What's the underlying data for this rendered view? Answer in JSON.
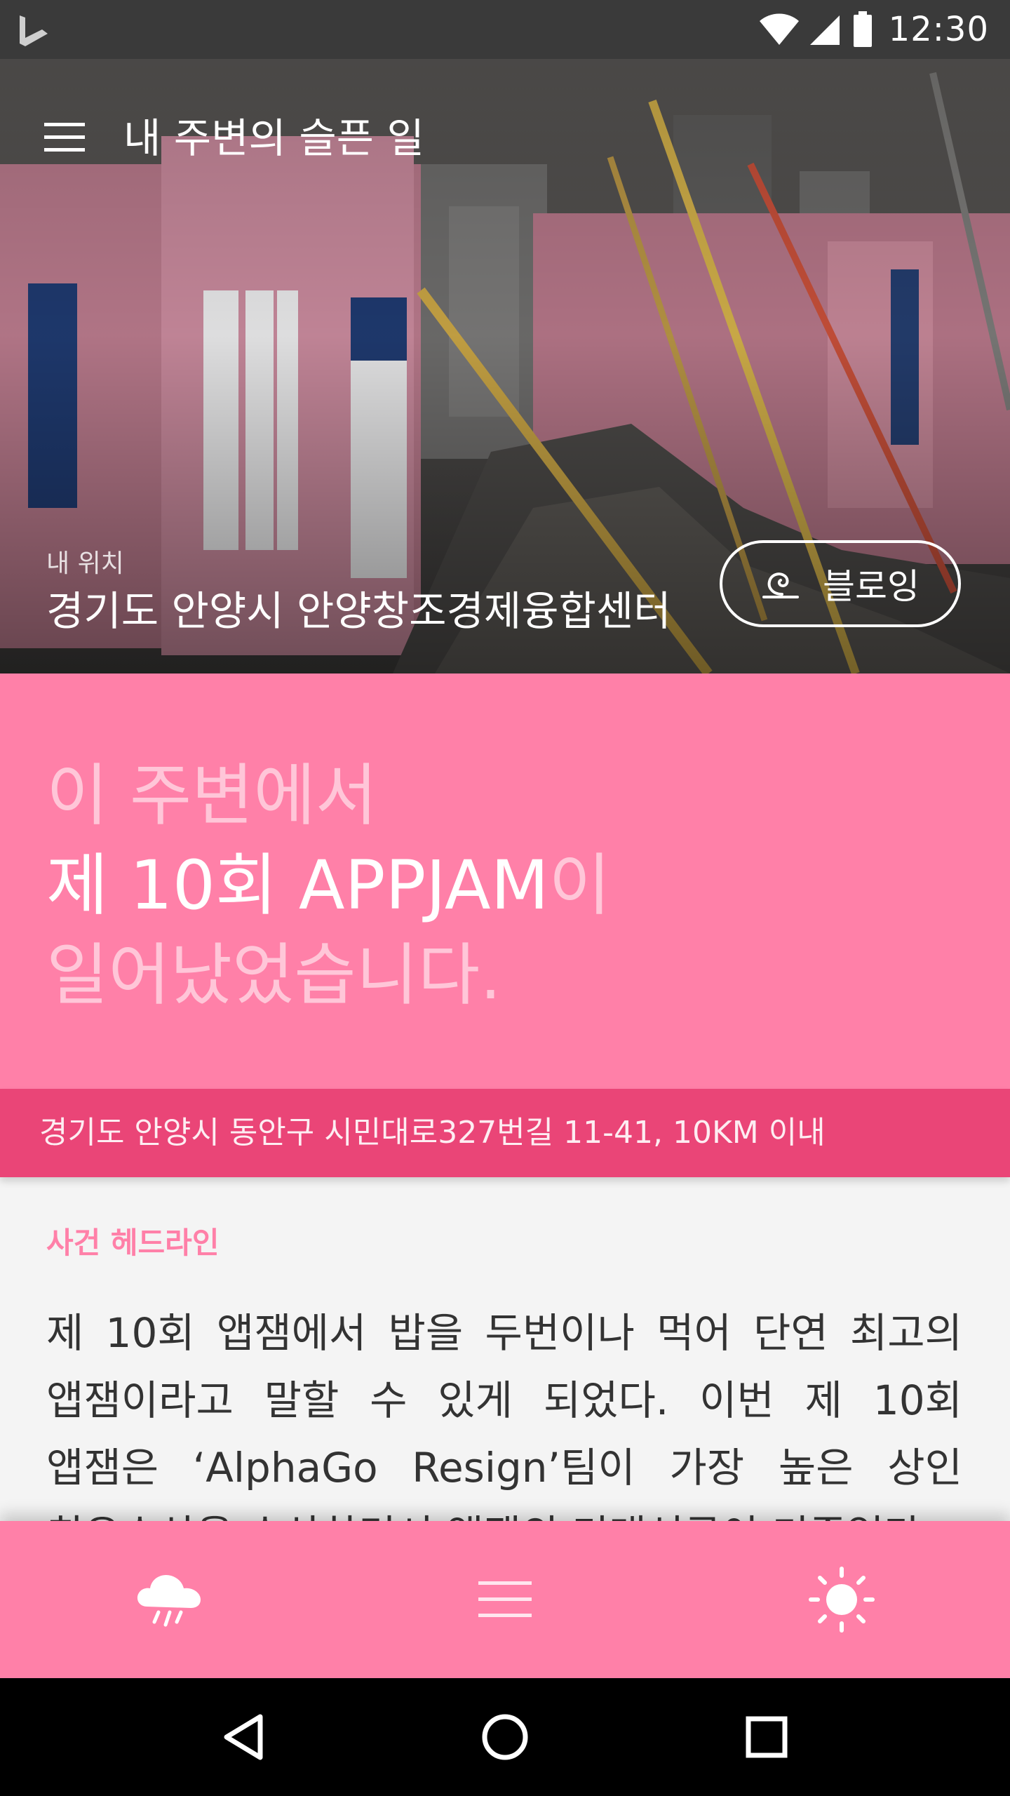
{
  "status_bar": {
    "time": "12:30"
  },
  "header": {
    "title": "내 주변의 슬픈 일",
    "menu_icon": "hamburger-icon"
  },
  "location": {
    "label": "내 위치",
    "value": "경기도 안양시 안양창조경제융합센터",
    "blowing_button_label": "블로잉",
    "blowing_icon": "swirl-icon"
  },
  "headline": {
    "line1": "이 주변에서",
    "event_name": "제 10회 APPJAM",
    "particle": "이",
    "line3": "일어났었습니다."
  },
  "address": {
    "text": "경기도 안양시 동안구 시민대로327번길 11-41, 10KM 이내"
  },
  "article": {
    "section_label": "사건 헤드라인",
    "body": "제 10회 앱잼에서 밥을 두번이나 먹어 단연 최고의 앱잼이라고 말할 수 있게 되었다. 이번 제 10회 앱잼은 ‘AlphaGo Resign’팀이 가장 높은 상인 최우수상을 수상하면서 앱잼의 미래성공이 기종업다"
  },
  "bottom_tabs": [
    {
      "icon": "rain-cloud-icon"
    },
    {
      "icon": "list-icon"
    },
    {
      "icon": "sun-icon"
    }
  ],
  "nav_bar": {
    "back_icon": "back-triangle-icon",
    "home_icon": "home-circle-icon",
    "recents_icon": "recents-square-icon"
  },
  "colors": {
    "accent_pink": "#ff80a8",
    "dark_pink": "#ea4577",
    "status_bar": "#3a3a3a",
    "background": "#f4f4f4"
  }
}
